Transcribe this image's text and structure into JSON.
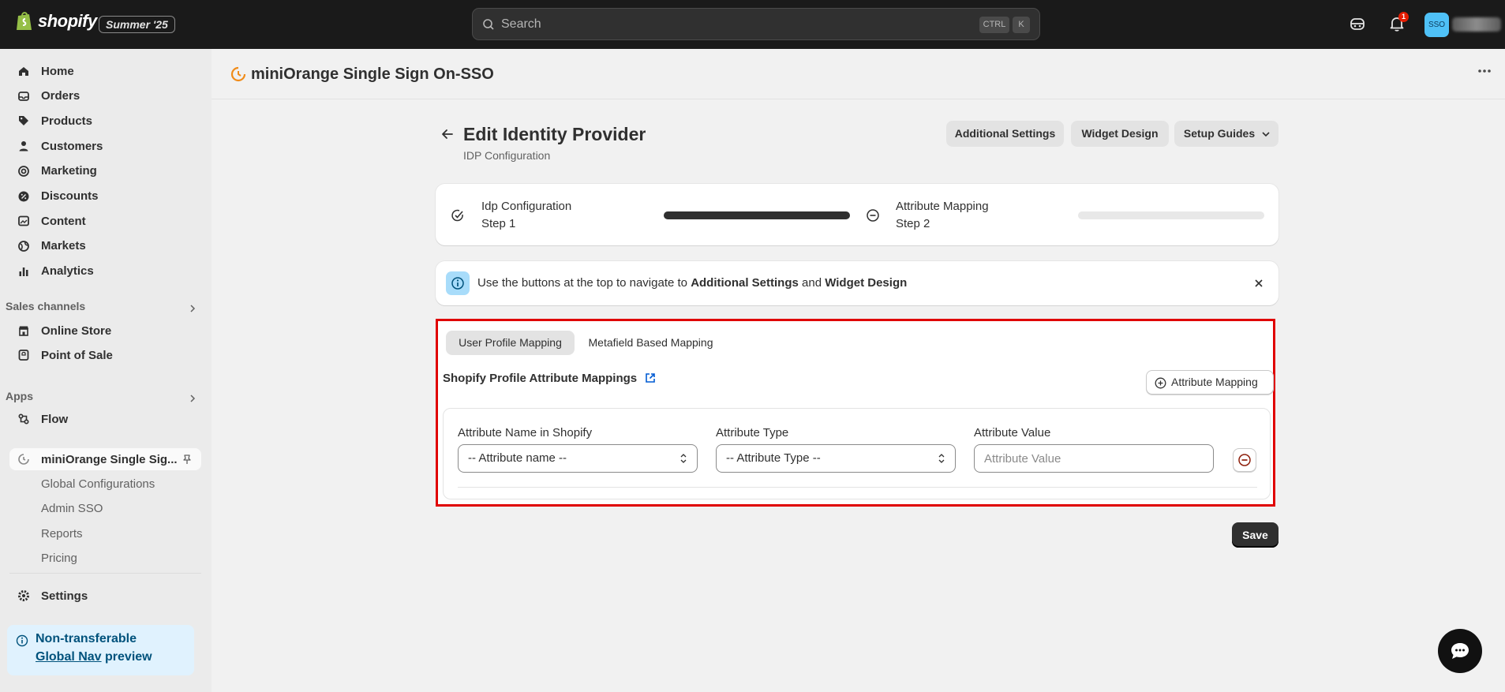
{
  "topbar": {
    "brand": "shopify",
    "edition": "Summer '25",
    "search_placeholder": "Search",
    "shortcut_ctrl": "CTRL",
    "shortcut_k": "K",
    "notification_count": "1",
    "avatar_initials": "SSO"
  },
  "sidebar": {
    "nav": [
      {
        "label": "Home",
        "icon": "home-icon"
      },
      {
        "label": "Orders",
        "icon": "orders-icon"
      },
      {
        "label": "Products",
        "icon": "tag-icon"
      },
      {
        "label": "Customers",
        "icon": "person-icon"
      },
      {
        "label": "Marketing",
        "icon": "target-icon"
      },
      {
        "label": "Discounts",
        "icon": "discount-icon"
      },
      {
        "label": "Content",
        "icon": "content-icon"
      },
      {
        "label": "Markets",
        "icon": "globe-icon"
      },
      {
        "label": "Analytics",
        "icon": "chart-icon"
      }
    ],
    "sales_channels_title": "Sales channels",
    "sales_channels": [
      {
        "label": "Online Store",
        "icon": "store-icon"
      },
      {
        "label": "Point of Sale",
        "icon": "pos-icon"
      }
    ],
    "apps_title": "Apps",
    "apps": [
      {
        "label": "Flow",
        "icon": "flow-icon"
      }
    ],
    "pinned_app": "miniOrange Single Sig...",
    "pinned_subitems": [
      "Global Configurations",
      "Admin SSO",
      "Reports",
      "Pricing"
    ],
    "settings_label": "Settings",
    "preview": {
      "line1": "Non-transferable",
      "link": "Global Nav",
      "rest": " preview"
    }
  },
  "app_header": {
    "title": "miniOrange Single Sign On-SSO"
  },
  "page": {
    "title": "Edit Identity Provider",
    "subtitle": "IDP Configuration",
    "buttons": {
      "additional_settings": "Additional Settings",
      "widget_design": "Widget Design",
      "setup_guides": "Setup Guides"
    },
    "steps": [
      {
        "title": "Idp Configuration",
        "step": "Step 1",
        "state": "complete",
        "progress": 1.0
      },
      {
        "title": "Attribute Mapping",
        "step": "Step 2",
        "state": "in-progress",
        "progress": 0.0
      }
    ],
    "banner": {
      "text_before": "Use the buttons at the top to navigate to ",
      "bold1": "Additional Settings",
      "middle": " and ",
      "bold2": "Widget Design"
    },
    "tabs": [
      "User Profile Mapping",
      "Metafield Based Mapping"
    ],
    "active_tab": "User Profile Mapping",
    "section_title": "Shopify Profile Attribute Mappings",
    "add_button": "Attribute Mapping",
    "fields": {
      "name_label": "Attribute Name in Shopify",
      "name_value": "-- Attribute name --",
      "type_label": "Attribute Type",
      "type_value": "-- Attribute Type --",
      "value_label": "Attribute Value",
      "value_placeholder": "Attribute Value"
    },
    "save_label": "Save"
  },
  "colors": {
    "topbar_bg": "#1a1a1a",
    "highlight_border": "#e00000",
    "primary_button": "#303030",
    "info_banner": "#e0f2fe"
  }
}
